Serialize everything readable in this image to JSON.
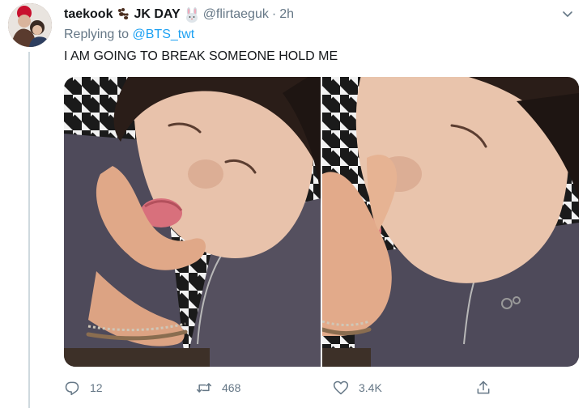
{
  "tweet": {
    "display_name": "taekook",
    "name_suffix": "JK DAY",
    "handle": "@flirtaeguk",
    "separator": "·",
    "time": "2h",
    "replying_prefix": "Replying to",
    "replying_handle": "@BTS_twt",
    "text": "I AM GOING TO BREAK SOMEONE HOLD ME"
  },
  "actions": {
    "replies": "12",
    "retweets": "468",
    "likes": "3.4K"
  },
  "icons": {
    "caret": "chevron-down-icon",
    "paw": "paw-prints-emoji",
    "rabbit": "rabbit-face-emoji",
    "reply": "reply-icon",
    "retweet": "retweet-icon",
    "like": "heart-icon",
    "share": "share-icon"
  },
  "colors": {
    "link": "#1da1f2",
    "muted": "#657786",
    "text": "#14171a"
  }
}
